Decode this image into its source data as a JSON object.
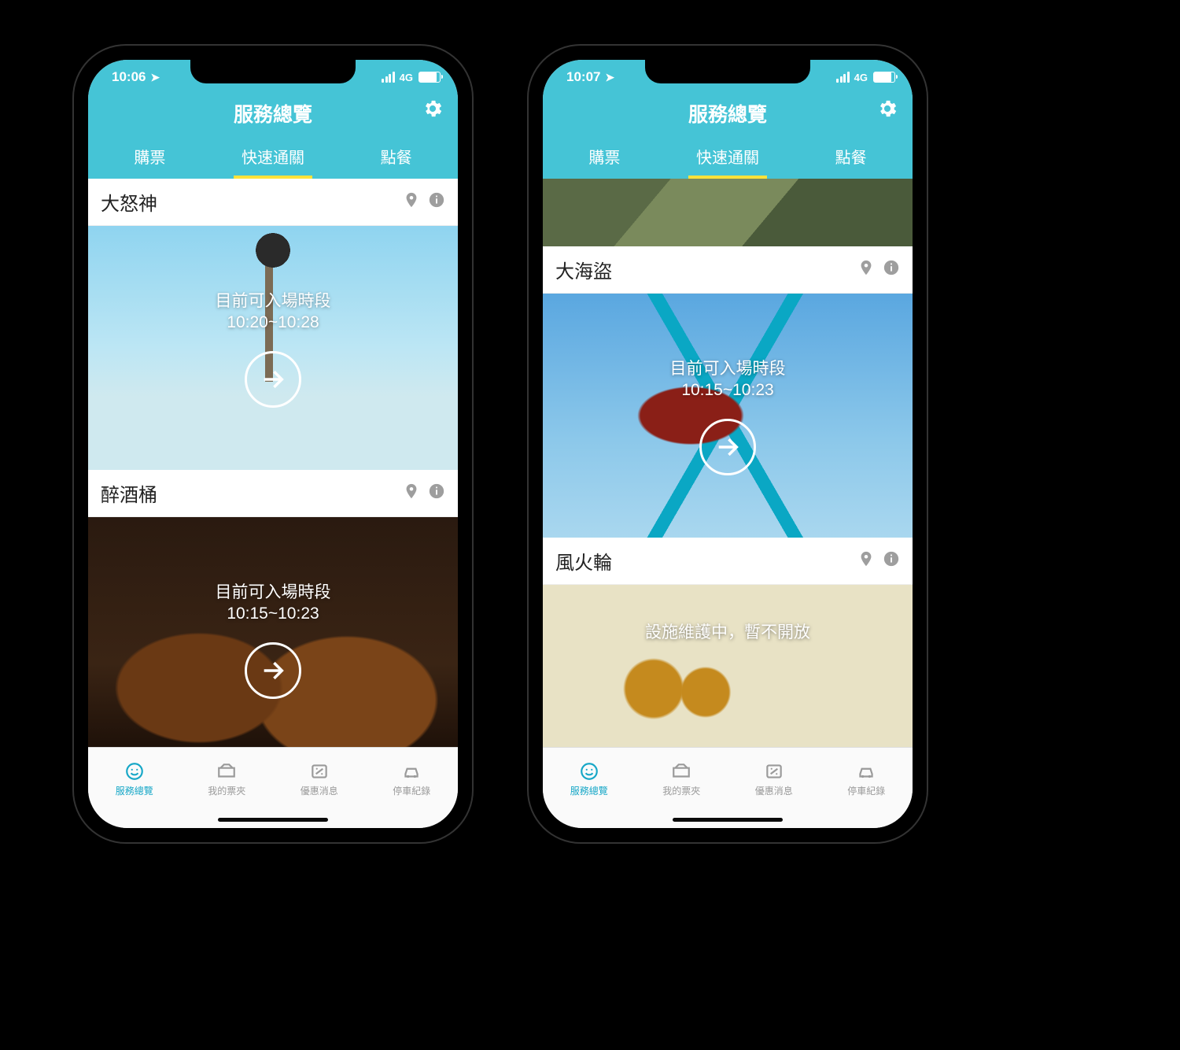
{
  "colors": {
    "accent": "#45c4d6",
    "tab_underline": "#ffe23a",
    "active_tab_icon": "#16a7c7",
    "muted": "#9e9e9e"
  },
  "phones": {
    "left": {
      "status": {
        "time": "10:06",
        "network": "4G"
      },
      "header": {
        "title": "服務總覽"
      },
      "tabs": {
        "buy": "購票",
        "fast": "快速通關",
        "food": "點餐",
        "active": "fast"
      },
      "items": [
        {
          "title": "大怒神",
          "line1": "目前可入場時段",
          "line2": "10:20~10:28"
        },
        {
          "title": "醉酒桶",
          "line1": "目前可入場時段",
          "line2": "10:15~10:23"
        }
      ]
    },
    "right": {
      "status": {
        "time": "10:07",
        "network": "4G"
      },
      "header": {
        "title": "服務總覽"
      },
      "tabs": {
        "buy": "購票",
        "fast": "快速通關",
        "food": "點餐",
        "active": "fast"
      },
      "items": [
        {
          "title": "大海盜",
          "line1": "目前可入場時段",
          "line2": "10:15~10:23"
        },
        {
          "title": "風火輪",
          "maint": "設施維護中，暫不開放"
        }
      ]
    }
  },
  "tabbar": {
    "services": "服務總覽",
    "tickets": "我的票夾",
    "promos": "優惠消息",
    "parking": "停車紀錄",
    "active": "services"
  }
}
